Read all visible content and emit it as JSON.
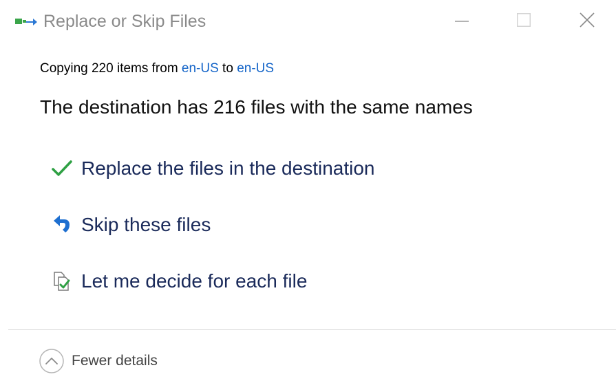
{
  "window": {
    "title": "Replace or Skip Files",
    "minimize_icon": "minimize-icon",
    "maximize_icon": "maximize-icon",
    "close_icon": "close-icon"
  },
  "summary": {
    "prefix": "Copying 220 items from ",
    "source": "en-US",
    "middle": " to ",
    "destination": "en-US"
  },
  "headline": "The destination has 216 files with the same names",
  "options": [
    {
      "label": "Replace the files in the destination",
      "icon": "checkmark-icon",
      "color": "#2ea043"
    },
    {
      "label": "Skip these files",
      "icon": "skip-arrow-icon",
      "color": "#1e6fd0"
    },
    {
      "label": "Let me decide for each file",
      "icon": "compare-files-icon",
      "color": "#2ea043"
    }
  ],
  "footer": {
    "details_label": "Fewer details",
    "details_icon": "chevron-up-circle-icon"
  },
  "colors": {
    "link": "#1565c8",
    "title_text": "#8a8a8a",
    "option_text": "#1a2a5a"
  }
}
